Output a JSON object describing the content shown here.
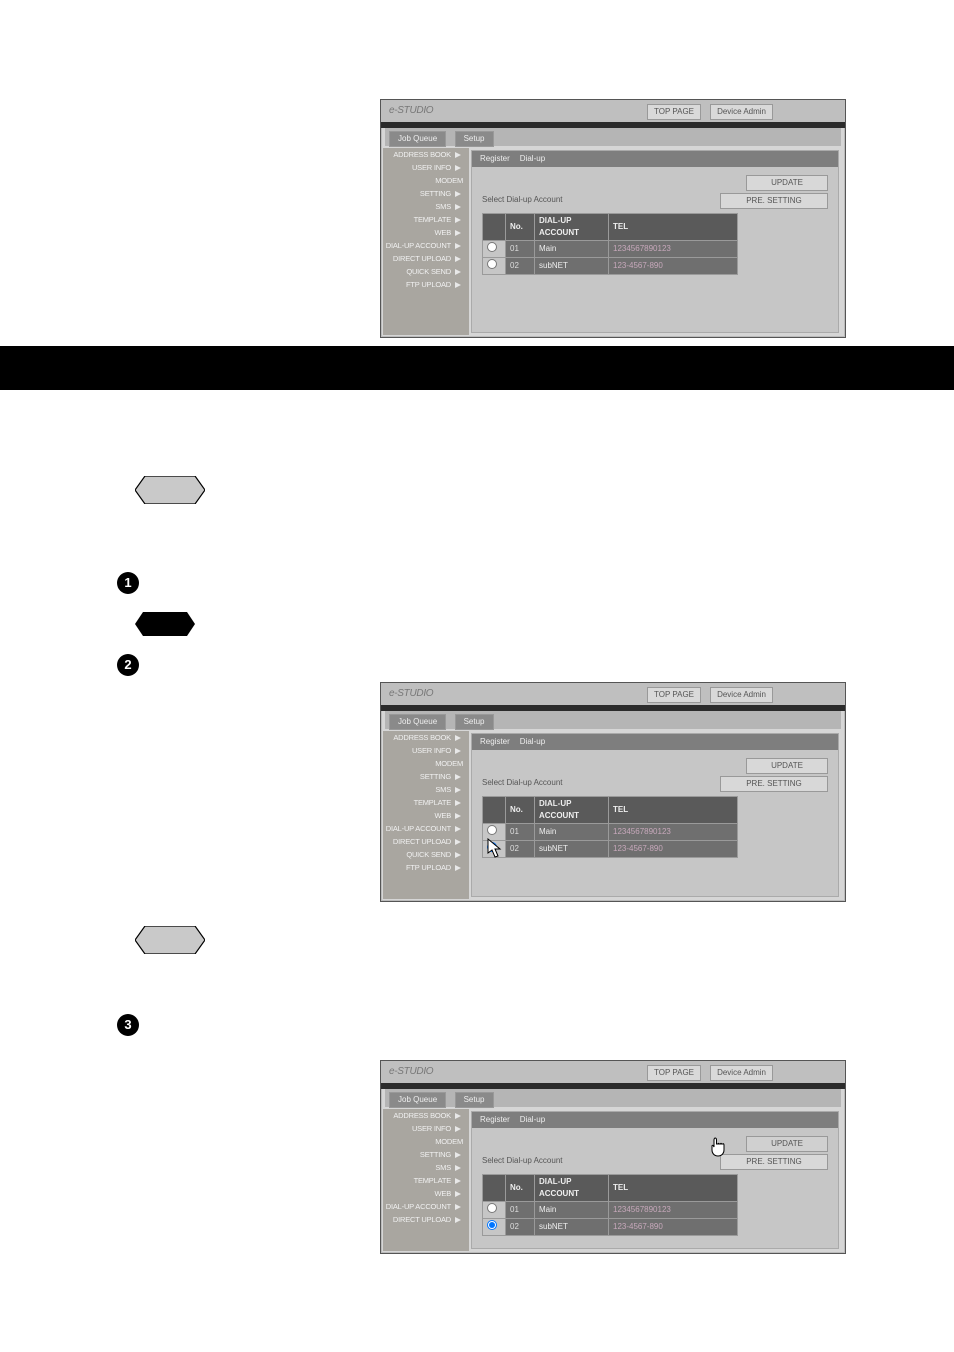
{
  "shots": {
    "brand": "e-STUDIO",
    "top_buttons": {
      "top_page": "TOP PAGE",
      "device": "Device Admin"
    },
    "subtabs": {
      "tab1": "Job Queue",
      "tab2": "Setup"
    },
    "sidebar": {
      "items": [
        {
          "label": "ADDRESS BOOK"
        },
        {
          "label": "USER INFO"
        },
        {
          "label": "MODEM"
        },
        {
          "label": "SETTING"
        },
        {
          "label": "SMS"
        },
        {
          "label": "TEMPLATE"
        },
        {
          "label": "WEB"
        },
        {
          "label": "DIAL-UP ACCOUNT"
        },
        {
          "label": "DIRECT UPLOAD"
        },
        {
          "label": "QUICK SEND"
        },
        {
          "label": "FTP UPLOAD"
        }
      ]
    },
    "main": {
      "head_label1": "Register",
      "head_label2": "Dial-up",
      "action_update": "UPDATE",
      "action_pre": "PRE. SETTING",
      "select_label": "Select Dial-up Account",
      "table": {
        "cols": {
          "no": "No.",
          "acct": "DIAL-UP ACCOUNT",
          "tel": "TEL"
        },
        "rows": [
          {
            "no": "01",
            "acct": "Main",
            "tel": "1234567890123"
          },
          {
            "no": "02",
            "acct": "subNET",
            "tel": "123-4567-890"
          }
        ]
      }
    }
  },
  "numbers": {
    "n1": "1",
    "n2": "2",
    "n3": "3"
  }
}
